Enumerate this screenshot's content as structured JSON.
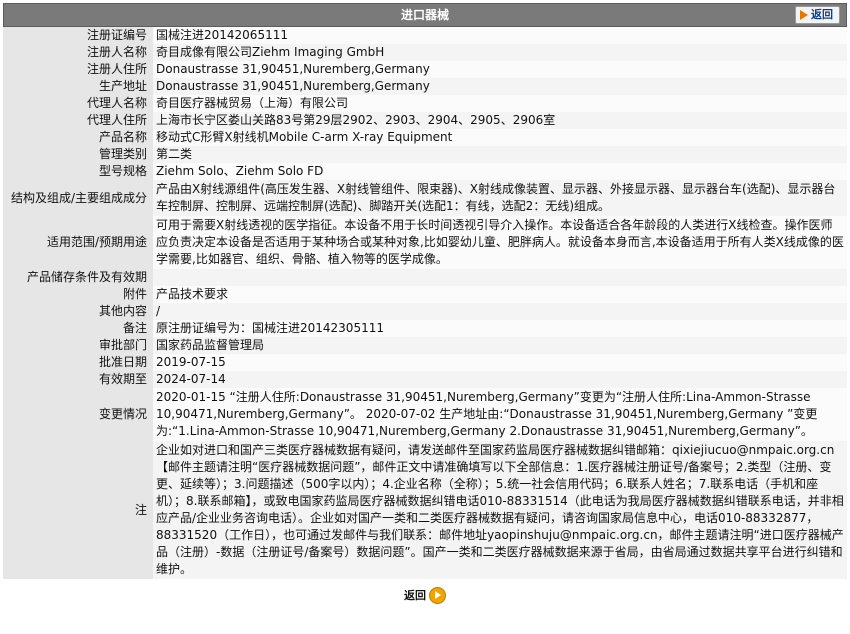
{
  "header": {
    "title": "进口器械",
    "back_label": "返回"
  },
  "rows": [
    {
      "label": "注册证编号",
      "value": "国械注进20142065111"
    },
    {
      "label": "注册人名称",
      "value": "奇目成像有限公司Ziehm Imaging GmbH"
    },
    {
      "label": "注册人住所",
      "value": "Donaustrasse 31,90451,Nuremberg,Germany"
    },
    {
      "label": "生产地址",
      "value": "Donaustrasse 31,90451,Nuremberg,Germany"
    },
    {
      "label": "代理人名称",
      "value": "奇目医疗器械贸易（上海）有限公司"
    },
    {
      "label": "代理人住所",
      "value": "上海市长宁区娄山关路83号第29层2902、2903、2904、2905、2906室"
    },
    {
      "label": "产品名称",
      "value": "移动式C形臂X射线机Mobile C-arm X-ray Equipment"
    },
    {
      "label": "管理类别",
      "value": "第二类"
    },
    {
      "label": "型号规格",
      "value": "Ziehm Solo、Ziehm Solo FD"
    },
    {
      "label": "结构及组成/主要组成成分",
      "value": "产品由X射线源组件(高压发生器、X射线管组件、限束器)、X射线成像装置、显示器、外接显示器、显示器台车(选配)、显示器台车控制屏、控制屏、远端控制屏(选配)、脚踏开关(选配1：有线，选配2：无线)组成。"
    },
    {
      "label": "适用范围/预期用途",
      "value": "可用于需要X射线透视的医学指征。本设备不用于长时间透视引导介入操作。本设备适合各年龄段的人类进行X线检查。操作医师应负责决定本设备是否适用于某种场合或某种对象,比如婴幼儿童、肥胖病人。就设备本身而言,本设备适用于所有人类X线成像的医学需要,比如器官、组织、骨骼、植入物等的医学成像。"
    },
    {
      "label": "产品储存条件及有效期",
      "value": ""
    },
    {
      "label": "附件",
      "value": "产品技术要求"
    },
    {
      "label": "其他内容",
      "value": "/"
    },
    {
      "label": "备注",
      "value": "原注册证编号为：国械注进20142305111"
    },
    {
      "label": "审批部门",
      "value": "国家药品监督管理局"
    },
    {
      "label": "批准日期",
      "value": "2019-07-15"
    },
    {
      "label": "有效期至",
      "value": "2024-07-14"
    },
    {
      "label": "变更情况",
      "value": "2020-01-15 “注册人住所:Donaustrasse 31,90451,Nuremberg,Germany”变更为“注册人住所:Lina-Ammon-Strasse 10,90471,Nuremberg,Germany”。 2020-07-02 生产地址由:“Donaustrasse 31,90451,Nuremberg,Germany ”变更为:“1.Lina-Ammon-Strasse 10,90471,Nuremberg,Germany 2.Donaustrasse 31,90451,Nuremberg,Germany”。"
    },
    {
      "label": "注",
      "value": "企业如对进口和国产三类医疗器械数据有疑问，请发送邮件至国家药监局医疗器械数据纠错邮箱：qixiejiucuo@nmpaic.org.cn【邮件主题请注明“医疗器械数据问题”，邮件正文中请准确填写以下全部信息：1.医疗器械注册证号/备案号；2.类型（注册、变更、延续等）；3.问题描述（500字以内）；4.企业名称（全称）；5.统一社会信用代码；6.联系人姓名；7.联系电话（手机和座机）；8.联系邮箱】，或致电国家药监局医疗器械数据纠错电话010-88331514（此电话为我局医疗器械数据纠错联系电话，并非相应产品/企业业务咨询电话）。企业如对国产一类和二类医疗器械数据有疑问，请咨询国家局信息中心，电话010-88332877，88331520（工作日），也可通过发邮件与我们联系：邮件地址yaopinshuju@nmpaic.org.cn，邮件主题请注明“进口医疗器械产品（注册）-数据（注册证号/备案号）数据问题”。国产一类和二类医疗器械数据来源于省局，由省局通过数据共享平台进行纠错和维护。"
    }
  ],
  "footer": {
    "back_label": "返回"
  }
}
